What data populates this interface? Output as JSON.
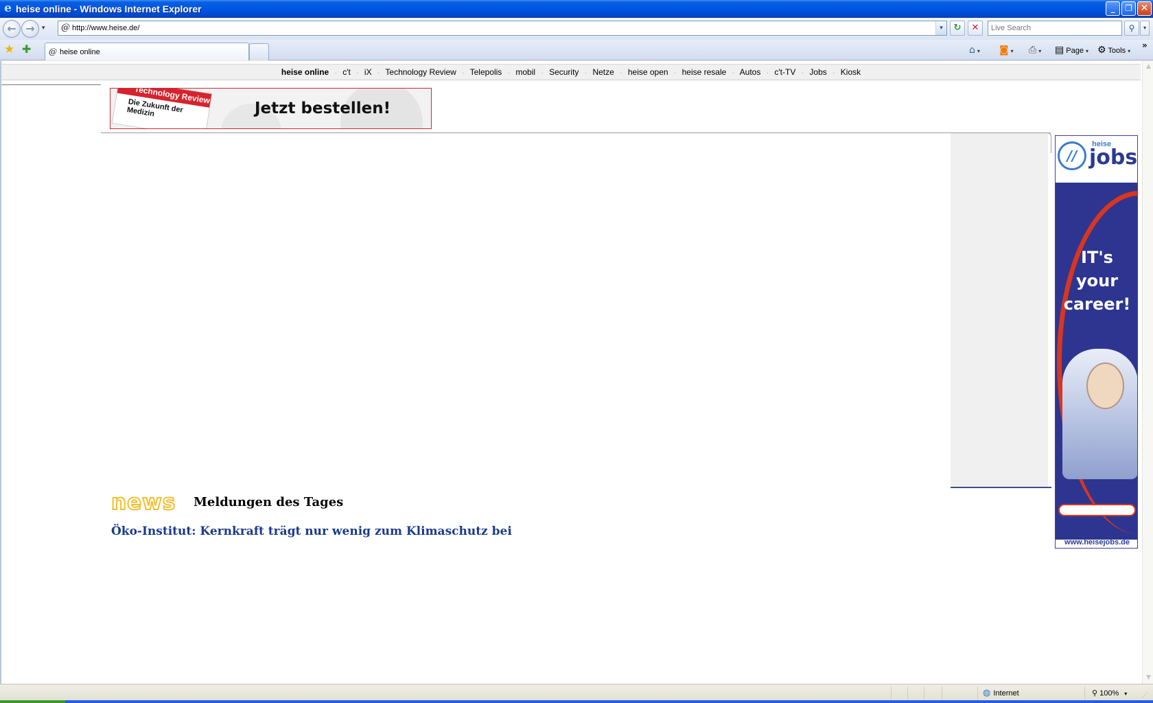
{
  "window": {
    "title": "heise online - Windows Internet Explorer",
    "minimize_glyph": "_",
    "maximize_glyph": "❐",
    "close_glyph": "✕"
  },
  "toolbar": {
    "address": "http://www.heise.de/",
    "search_placeholder": "Live Search",
    "back_glyph": "←",
    "forward_glyph": "→",
    "refresh_glyph": "↻",
    "stop_glyph": "✕",
    "search_glyph": "⚲",
    "dropdown_glyph": "▾"
  },
  "tabs": {
    "active_label": "heise online",
    "page_label": "Page",
    "tools_label": "Tools",
    "favorites_glyph": "★",
    "add_favorite_glyph": "✚",
    "home_glyph": "⌂",
    "feeds_glyph": "◙",
    "print_glyph": "⎙",
    "page_glyph": "▤",
    "tools_glyph": "⚙",
    "more_glyph": "»"
  },
  "site_nav": {
    "current": "heise online",
    "items": [
      "c't",
      "iX",
      "Technology Review",
      "Telepolis",
      "mobil",
      "Security",
      "Netze",
      "heise open",
      "heise resale",
      "Autos",
      "c't-TV",
      "Jobs",
      "Kiosk"
    ],
    "separator": "·"
  },
  "banner": {
    "magazine_title": "Technology Review",
    "magazine_cover_text": "Die Zukunft der Medizin",
    "cta": "Jetzt bestellen!"
  },
  "jobs_ad": {
    "logo_small": "heise",
    "logo_big": "jobs",
    "logo_mark": "//",
    "headline": [
      "IT's",
      "your",
      "career!"
    ],
    "url": "www.heisejobs.de"
  },
  "news": {
    "logo": "news",
    "heading": "Meldungen des Tages",
    "headline": "Öko-Institut: Kernkraft trägt nur wenig zum Klimaschutz bei"
  },
  "status": {
    "zone": "Internet",
    "zoom": "100%",
    "zone_glyph": "◍",
    "zoom_glyph": "⚲"
  },
  "colors": {
    "titlebar": "#0055e5",
    "link": "#1a3a8c",
    "banner_border": "#cc2b35",
    "jobs_blue": "#2e3590",
    "jobs_red": "#d8361e",
    "news_yellow": "#f0c030"
  }
}
